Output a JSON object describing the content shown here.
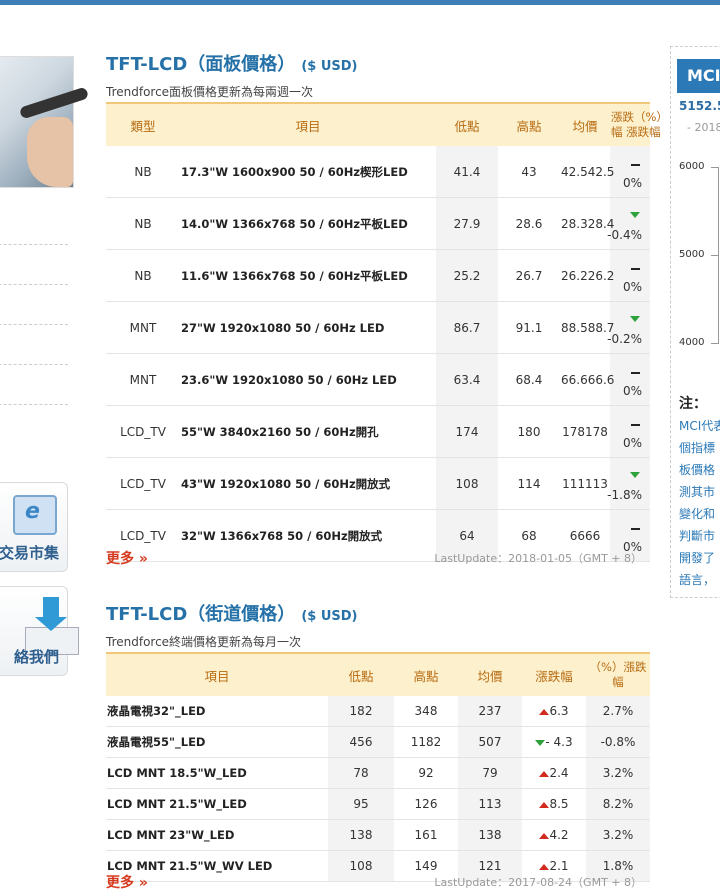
{
  "sidebar": {
    "exchange_label": "交易市集",
    "contact_label": "絡我們"
  },
  "panel_price": {
    "title": "TFT-LCD（面板價格）",
    "currency": "($ USD)",
    "subtitle": "Trendforce面板價格更新為每兩週一次",
    "headers": {
      "type": "類型",
      "item": "項目",
      "low": "低點",
      "high": "高點",
      "avg": "均價",
      "chg_top": "漲跌（%）",
      "chg_bottom_a": "幅",
      "chg_bottom_b": "漲跌幅"
    },
    "rows": [
      {
        "type": "NB",
        "item": "17.3\"W 1600x900 50 / 60Hz楔形LED",
        "low": "41.4",
        "high": "43",
        "avg": "42.5",
        "avg2": "42.5",
        "dir": "flat",
        "pct": "0%"
      },
      {
        "type": "NB",
        "item": "14.0\"W 1366x768 50 / 60Hz平板LED",
        "low": "27.9",
        "high": "28.6",
        "avg": "28.3",
        "avg2": "28.4",
        "dir": "down",
        "pct": "-0.4%"
      },
      {
        "type": "NB",
        "item": "11.6\"W 1366x768 50 / 60Hz平板LED",
        "low": "25.2",
        "high": "26.7",
        "avg": "26.2",
        "avg2": "26.2",
        "dir": "flat",
        "pct": "0%"
      },
      {
        "type": "MNT",
        "item": "27\"W 1920x1080 50 / 60Hz LED",
        "low": "86.7",
        "high": "91.1",
        "avg": "88.5",
        "avg2": "88.7",
        "dir": "down",
        "pct": "-0.2%"
      },
      {
        "type": "MNT",
        "item": "23.6\"W 1920x1080 50 / 60Hz LED",
        "low": "63.4",
        "high": "68.4",
        "avg": "66.6",
        "avg2": "66.6",
        "dir": "flat",
        "pct": "0%"
      },
      {
        "type": "LCD_TV",
        "item": "55\"W 3840x2160 50 / 60Hz開孔",
        "low": "174",
        "high": "180",
        "avg": "178",
        "avg2": "178",
        "dir": "flat",
        "pct": "0%"
      },
      {
        "type": "LCD_TV",
        "item": "43\"W 1920x1080 50 / 60Hz開放式",
        "low": "108",
        "high": "114",
        "avg": "111",
        "avg2": "113",
        "dir": "down",
        "pct": "-1.8%"
      },
      {
        "type": "LCD_TV",
        "item": "32\"W 1366x768 50 / 60Hz開放式",
        "low": "64",
        "high": "68",
        "avg": "66",
        "avg2": "66",
        "dir": "flat",
        "pct": "0%"
      }
    ],
    "more": "更多 »",
    "last_update": "LastUpdate：2018-01-05（GMT + 8）"
  },
  "street_price": {
    "title": "TFT-LCD（街道價格）",
    "currency": "($ USD)",
    "subtitle": "Trendforce終端價格更新為每月一次",
    "headers": {
      "item": "項目",
      "low": "低點",
      "high": "高點",
      "avg": "均價",
      "chg": "漲跌幅",
      "pct": "（%）漲跌幅"
    },
    "rows": [
      {
        "item": "液晶電視32\"_LED",
        "low": "182",
        "high": "348",
        "avg": "237",
        "dir": "up",
        "chg": "6.3",
        "pct": "2.7%"
      },
      {
        "item": "液晶電視55\"_LED",
        "low": "456",
        "high": "1182",
        "avg": "507",
        "dir": "down",
        "chg": "- 4.3",
        "pct": "-0.8%"
      },
      {
        "item": "LCD MNT 18.5\"W_LED",
        "low": "78",
        "high": "92",
        "avg": "79",
        "dir": "up",
        "chg": "2.4",
        "pct": "3.2%"
      },
      {
        "item": "LCD MNT 21.5\"W_LED",
        "low": "95",
        "high": "126",
        "avg": "113",
        "dir": "up",
        "chg": "8.5",
        "pct": "8.2%"
      },
      {
        "item": "LCD MNT 23\"W_LED",
        "low": "138",
        "high": "161",
        "avg": "138",
        "dir": "up",
        "chg": "4.2",
        "pct": "3.2%"
      },
      {
        "item": "LCD MNT 21.5\"W_WV LED",
        "low": "108",
        "high": "149",
        "avg": "121",
        "dir": "up",
        "chg": "2.1",
        "pct": "1.8%"
      }
    ],
    "more": "更多 »",
    "last_update": "LastUpdate：2017-08-24（GMT + 8）"
  },
  "mci_panel": {
    "title": "MCI",
    "value": "5152.5",
    "date": "- 2018",
    "yticks": [
      "6000",
      "5000",
      "4000"
    ],
    "note_title": "注：",
    "note_lines": [
      "MCI代表",
      "個指標",
      "板價格",
      "測其市",
      "變化和",
      "判斷市",
      "開發了",
      "語言，"
    ]
  }
}
